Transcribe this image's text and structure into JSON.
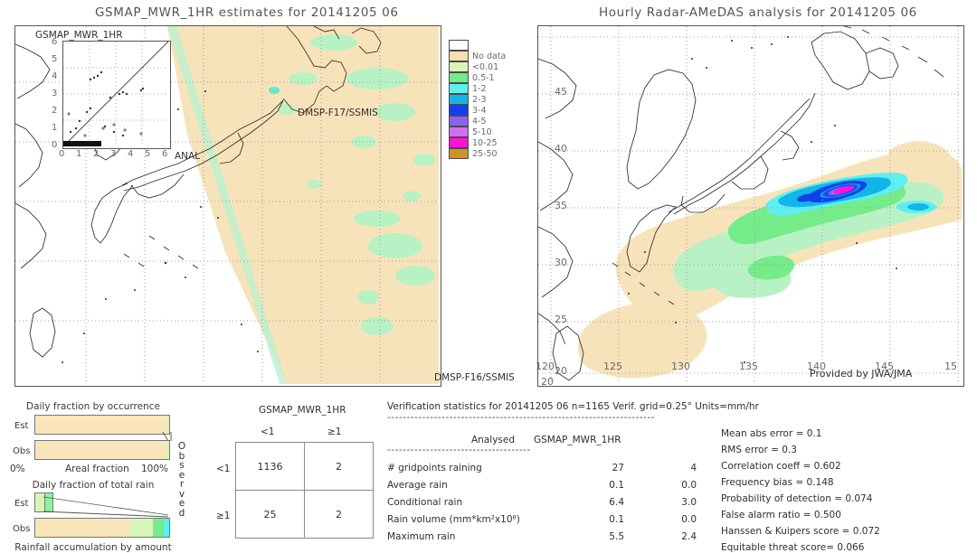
{
  "left_panel": {
    "title": "GSMAP_MWR_1HR estimates for 20141205 06",
    "inset": {
      "y_axis_label": "GSMAP_MWR_1HR",
      "x_axis_label": "ANAL",
      "x_ticks": [
        "0",
        "1",
        "2",
        "3",
        "4",
        "5",
        "6"
      ],
      "y_ticks": [
        "0",
        "1",
        "2",
        "3",
        "4",
        "5",
        "6"
      ]
    },
    "sensor_label_center": "DMSP-F17/SSMIS",
    "sensor_label_corner": "DMSP-F16/SSMIS"
  },
  "right_panel": {
    "title": "Hourly Radar-AMeDAS analysis for 20141205 06",
    "credit": "Provided by JWA/JMA",
    "lon_ticks": [
      "120",
      "125",
      "130",
      "135",
      "140",
      "145",
      "15"
    ],
    "lat_ticks": [
      "45",
      "40",
      "35",
      "30",
      "25",
      "20"
    ]
  },
  "colorbar": {
    "entries": [
      {
        "label": "",
        "color": "#ffffff"
      },
      {
        "label": "No data",
        "color": "#f5dfae"
      },
      {
        "label": "<0.01",
        "color": "#d8f5b8"
      },
      {
        "label": "0.5-1",
        "color": "#74ec8a"
      },
      {
        "label": "1-2",
        "color": "#5ef0f0"
      },
      {
        "label": "2-3",
        "color": "#12b5e8"
      },
      {
        "label": "3-4",
        "color": "#1040ec"
      },
      {
        "label": "4-5",
        "color": "#8a62f0"
      },
      {
        "label": "5-10",
        "color": "#d070ee"
      },
      {
        "label": "10-25",
        "color": "#fb13d6"
      },
      {
        "label": "25-50",
        "color": "#cf9428"
      }
    ]
  },
  "fraction_occurrence": {
    "title": "Daily fraction by occurrence",
    "row_est_label": "Est",
    "row_obs_label": "Obs",
    "axis_left": "0%",
    "axis_center": "Areal fraction",
    "axis_right": "100%",
    "est_segments": [
      {
        "color": "#fae5bb",
        "pct": 99.4
      },
      {
        "color": "#d8f5b8",
        "pct": 0.6
      }
    ],
    "obs_segments": [
      {
        "color": "#fae5bb",
        "pct": 97.7
      },
      {
        "color": "#d8f5b8",
        "pct": 2.3
      }
    ]
  },
  "fraction_total_rain": {
    "title": "Daily fraction of total rain",
    "row_est_label": "Est",
    "row_obs_label": "Obs",
    "caption": "Rainfall accumulation by amount",
    "est_segments": [
      {
        "color": "#d8f5b8",
        "pct": 8.0
      },
      {
        "color": "#8ff2a0",
        "pct": 6.0
      }
    ],
    "obs_segments": [
      {
        "color": "#fae5bb",
        "pct": 70.0
      },
      {
        "color": "#d8f5b8",
        "pct": 18.0
      },
      {
        "color": "#74ec8a",
        "pct": 8.0
      },
      {
        "color": "#5ef0f0",
        "pct": 4.0
      }
    ]
  },
  "contingency": {
    "title": "GSMAP_MWR_1HR",
    "col_headers": [
      "<1",
      "≧1"
    ],
    "col_headers_display": [
      "<1",
      "≥1"
    ],
    "row_headers": [
      "<1",
      "≥1"
    ],
    "observed_label": "Observed",
    "cells": [
      [
        "1136",
        "2"
      ],
      [
        "25",
        "2"
      ]
    ]
  },
  "verification": {
    "header": "Verification statistics for 20141205 06   n=1165   Verif. grid=0.25°   Units=mm/hr",
    "divider": "---------------------------------------------------------------------",
    "col_a": "Analysed",
    "col_b": "GSMAP_MWR_1HR",
    "divider2": "-------------------------------------",
    "rows": [
      {
        "name": "# gridpoints raining",
        "analysed": "27",
        "estimate": "4"
      },
      {
        "name": "Average rain",
        "analysed": "0.1",
        "estimate": "0.0"
      },
      {
        "name": "Conditional rain",
        "analysed": "6.4",
        "estimate": "3.0"
      },
      {
        "name": "Rain volume (mm*km²x10⁸)",
        "analysed": "0.1",
        "estimate": "0.0"
      },
      {
        "name": "Maximum rain",
        "analysed": "5.5",
        "estimate": "2.4"
      }
    ],
    "scores": [
      "Mean abs error = 0.1",
      "RMS error = 0.3",
      "Correlation coeff = 0.602",
      "Frequency bias = 0.148",
      "Probability of detection = 0.074",
      "False alarm ratio = 0.500",
      "Hanssen & Kuipers score = 0.072",
      "Equitable threat score= 0.066"
    ]
  }
}
